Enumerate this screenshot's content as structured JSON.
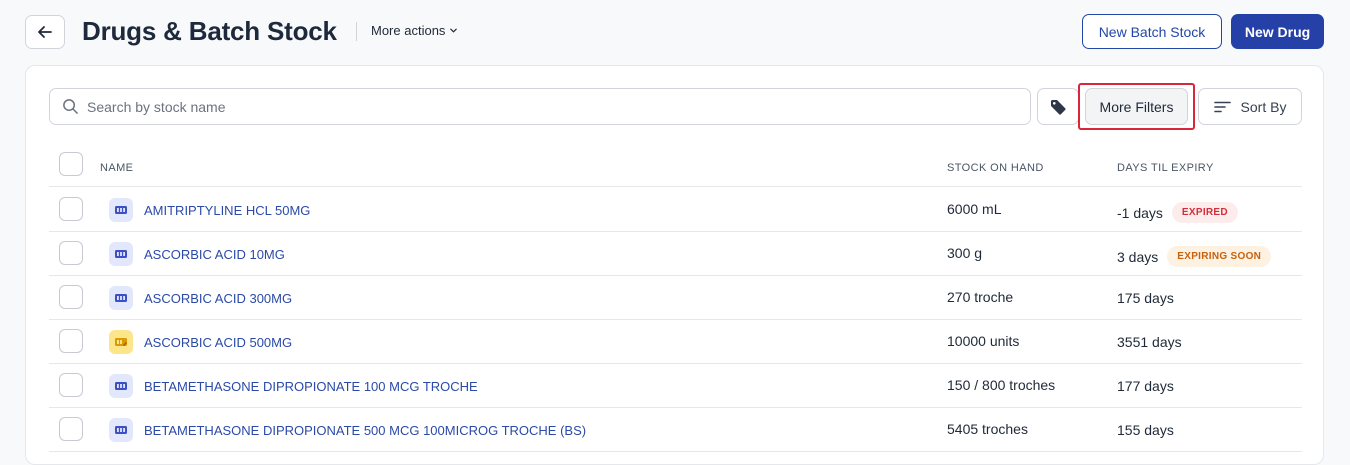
{
  "header": {
    "title": "Drugs & Batch Stock",
    "more_actions": "More actions",
    "new_batch_stock": "New Batch Stock",
    "new_drug": "New Drug"
  },
  "toolbar": {
    "search_placeholder": "Search by stock name",
    "more_filters": "More Filters",
    "sort_by": "Sort By"
  },
  "table": {
    "columns": {
      "name": "NAME",
      "stock": "STOCK ON HAND",
      "expiry": "DAYS TIL EXPIRY"
    },
    "rows": [
      {
        "name": "AMITRIPTYLINE HCL 50MG",
        "stock": "6000 mL",
        "expiry": "-1 days",
        "badge": "EXPIRED",
        "icon": "pill-box-icon"
      },
      {
        "name": "ASCORBIC ACID 10MG",
        "stock": "300 g",
        "expiry": "3 days",
        "badge": "EXPIRING SOON",
        "icon": "pill-box-icon"
      },
      {
        "name": "ASCORBIC ACID 300MG",
        "stock": "270 troche",
        "expiry": "175 days",
        "badge": "",
        "icon": "pill-box-icon"
      },
      {
        "name": "ASCORBIC ACID 500MG",
        "stock": "10000 units",
        "expiry": "3551 days",
        "badge": "",
        "icon": "pill-box-icon"
      },
      {
        "name": "BETAMETHASONE DIPROPIONATE 100 MCG TROCHE",
        "stock": "150 / 800 troches",
        "expiry": "177 days",
        "badge": "",
        "icon": "pill-box-icon"
      },
      {
        "name": "BETAMETHASONE DIPROPIONATE 500 MCG 100MICROG TROCHE (BS)",
        "stock": "5405 troches",
        "expiry": "155 days",
        "badge": "",
        "icon": "pill-box-icon"
      }
    ]
  },
  "colors": {
    "primary": "#2541a8",
    "link": "#2b4aa8",
    "expired_bg": "#fdecec",
    "expired_text": "#d32f3a",
    "soon_bg": "#fdf1e1",
    "soon_text": "#c6620f",
    "icon_blue_bg": "#e3e7fb",
    "icon_yellow_bg": "#fde68a"
  }
}
